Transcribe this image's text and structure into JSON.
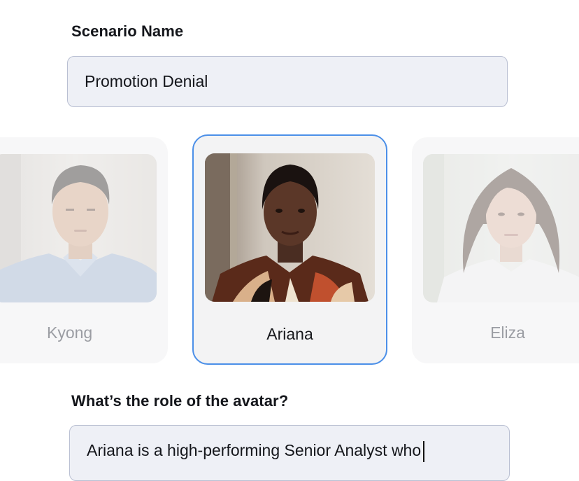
{
  "scenario": {
    "label": "Scenario Name",
    "value": "Promotion Denial"
  },
  "avatars": [
    {
      "name": "Kyong",
      "selected": false
    },
    {
      "name": "Ariana",
      "selected": true
    },
    {
      "name": "Eliza",
      "selected": false
    }
  ],
  "role": {
    "label": "What’s the role of the avatar?",
    "value": "Ariana is a high-performing Senior Analyst who"
  },
  "colors": {
    "selected_border": "#4b8fe8",
    "input_background": "#eef0f6"
  }
}
